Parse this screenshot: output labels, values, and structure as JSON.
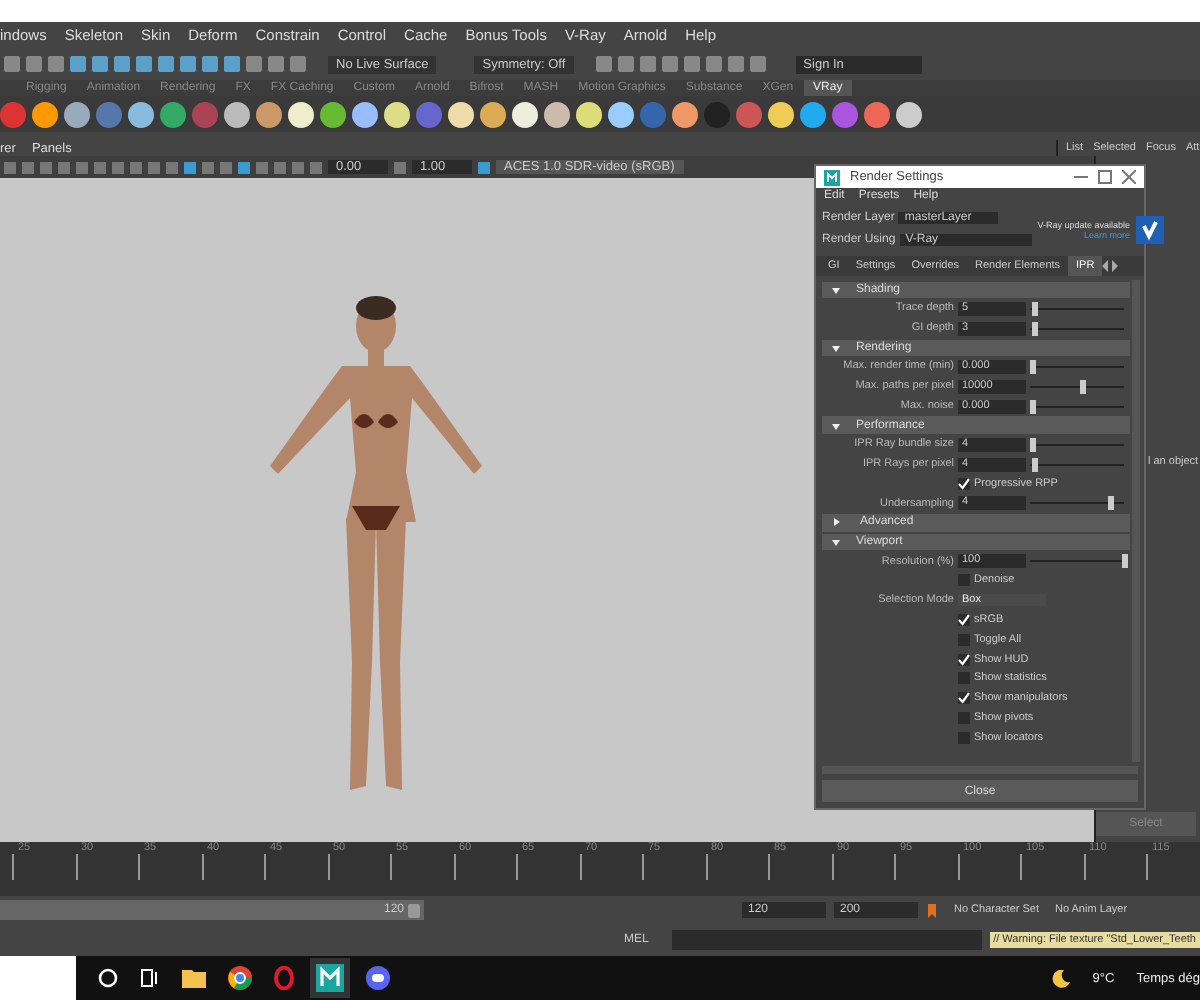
{
  "menu_bar": [
    "indows",
    "Skeleton",
    "Skin",
    "Deform",
    "Constrain",
    "Control",
    "Cache",
    "Bonus Tools",
    "V-Ray",
    "Arnold",
    "Help"
  ],
  "status_line": {
    "live_surface": "No Live Surface",
    "symmetry": "Symmetry: Off",
    "account": "Sign In"
  },
  "shelf_tabs": [
    {
      "label": "Rigging",
      "selected": false
    },
    {
      "label": "Animation",
      "selected": false
    },
    {
      "label": "Rendering",
      "selected": false
    },
    {
      "label": "FX",
      "selected": false
    },
    {
      "label": "FX Caching",
      "selected": false
    },
    {
      "label": "Custom",
      "selected": false
    },
    {
      "label": "Arnold",
      "selected": false
    },
    {
      "label": "Bifrost",
      "selected": false
    },
    {
      "label": "MASH",
      "selected": false
    },
    {
      "label": "Motion Graphics",
      "selected": false
    },
    {
      "label": "Substance",
      "selected": false
    },
    {
      "label": "XGen",
      "selected": false
    },
    {
      "label": "VRay",
      "selected": true
    }
  ],
  "panel_menu": [
    "rer",
    "Panels"
  ],
  "viewport_toolbar": {
    "exposure": "0.00",
    "gamma": "1.00",
    "color_space": "ACES 1.0 SDR-video (sRGB)"
  },
  "channel_box": {
    "tabs": [
      "List",
      "Selected",
      "Focus",
      "Att"
    ],
    "message": "l an object",
    "button": "Select"
  },
  "render_settings": {
    "title": "Render Settings",
    "menu": [
      "Edit",
      "Presets",
      "Help"
    ],
    "render_layer": {
      "label": "Render Layer",
      "value": "masterLayer"
    },
    "render_using": {
      "label": "Render Using",
      "value": "V-Ray"
    },
    "update_notice": "V-Ray update available",
    "update_link": "Learn more",
    "tabs": [
      {
        "label": "GI",
        "selected": false
      },
      {
        "label": "Settings",
        "selected": false
      },
      {
        "label": "Overrides",
        "selected": false
      },
      {
        "label": "Render Elements",
        "selected": false
      },
      {
        "label": "IPR",
        "selected": true
      }
    ],
    "sections": [
      {
        "title": "Shading",
        "expanded": true,
        "rows": [
          {
            "kind": "slider",
            "label": "Trace depth",
            "value": "5",
            "level": 0.05
          },
          {
            "kind": "slider",
            "label": "GI depth",
            "value": "3",
            "level": 0.05
          }
        ]
      },
      {
        "title": "Rendering",
        "expanded": true,
        "rows": [
          {
            "kind": "slider",
            "label": "Max. render time (min)",
            "value": "0.000",
            "level": 0.03
          },
          {
            "kind": "slider",
            "label": "Max. paths per pixel",
            "value": "10000",
            "level": 0.55
          },
          {
            "kind": "slider",
            "label": "Max. noise",
            "value": "0.000",
            "level": 0.03
          }
        ]
      },
      {
        "title": "Performance",
        "expanded": true,
        "rows": [
          {
            "kind": "slider",
            "label": "IPR Ray bundle size",
            "value": "4",
            "level": 0.03
          },
          {
            "kind": "slider",
            "label": "IPR Rays per pixel",
            "value": "4",
            "level": 0.05
          },
          {
            "kind": "checkbox",
            "label": "Progressive RPP",
            "checked": true
          },
          {
            "kind": "slider",
            "label": "Undersampling",
            "value": "4",
            "level": 0.85
          }
        ]
      },
      {
        "title": "Advanced",
        "expanded": false
      },
      {
        "title": "Viewport",
        "expanded": true,
        "rows": [
          {
            "kind": "slider",
            "label": "Resolution (%)",
            "value": "100",
            "level": 1
          },
          {
            "kind": "checkbox",
            "label": "Denoise",
            "checked": false
          },
          {
            "kind": "dropdown",
            "label": "Selection Mode",
            "value": "Box"
          },
          {
            "kind": "checkbox",
            "label": "sRGB",
            "checked": true
          },
          {
            "kind": "checkbox",
            "label": "Toggle All",
            "checked": false
          },
          {
            "kind": "checkbox",
            "label": "Show HUD",
            "checked": true
          },
          {
            "kind": "checkbox",
            "label": "Show statistics",
            "checked": false
          },
          {
            "kind": "checkbox",
            "label": "Show manipulators",
            "checked": true
          },
          {
            "kind": "checkbox",
            "label": "Show pivots",
            "checked": false
          },
          {
            "kind": "checkbox",
            "label": "Show locators",
            "checked": false
          }
        ]
      }
    ],
    "close": "Close"
  },
  "timeline": {
    "ticks": [
      "25",
      "30",
      "35",
      "40",
      "45",
      "50",
      "55",
      "60",
      "65",
      "70",
      "75",
      "80",
      "85",
      "90",
      "95",
      "100",
      "105",
      "110",
      "115"
    ]
  },
  "range_slider": {
    "level": 1,
    "range_end": "120",
    "end": "120",
    "playback_end": "200",
    "character_set": "No Character Set",
    "anim_layer": "No Anim Layer"
  },
  "command_line": {
    "language": "MEL",
    "feedback": "// Warning: File texture \"Std_Lower_Teeth"
  },
  "taskbar": {
    "temperature": "9°C",
    "weather": "Temps dég"
  }
}
